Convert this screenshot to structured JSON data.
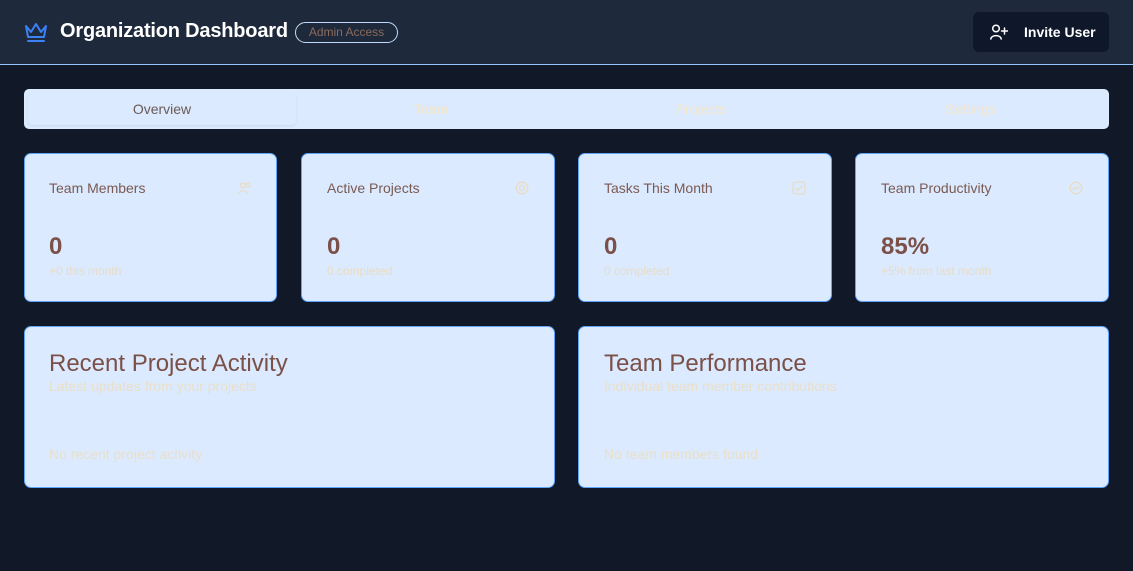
{
  "header": {
    "title": "Organization Dashboard",
    "badge": "Admin Access",
    "invite_label": "Invite User",
    "brand_icon": "crown-icon",
    "invite_icon": "user-plus-icon"
  },
  "tabs": [
    {
      "label": "Overview",
      "active": true
    },
    {
      "label": "Team",
      "active": false
    },
    {
      "label": "Projects",
      "active": false
    },
    {
      "label": "Settings",
      "active": false
    }
  ],
  "stats": [
    {
      "label": "Team Members",
      "value": "0",
      "sub": "+0 this month",
      "icon": "users-icon"
    },
    {
      "label": "Active Projects",
      "value": "0",
      "sub": "0 completed",
      "icon": "folder-icon"
    },
    {
      "label": "Tasks This Month",
      "value": "0",
      "sub": "0 completed",
      "icon": "check-icon"
    },
    {
      "label": "Team Productivity",
      "value": "85%",
      "sub": "+5% from last month",
      "icon": "trend-icon"
    }
  ],
  "panels": {
    "activity": {
      "title": "Recent Project Activity",
      "subtitle": "Latest updates from your projects",
      "empty": "No recent project activity"
    },
    "performance": {
      "title": "Team Performance",
      "subtitle": "Individual team member contributions",
      "empty": "No team members found"
    }
  },
  "colors": {
    "background": "#111827",
    "header": "#1e293b",
    "card": "#dbeafe",
    "card_border": "#60a5fa",
    "accent": "#3b82f6",
    "value_text": "#7a5048"
  }
}
